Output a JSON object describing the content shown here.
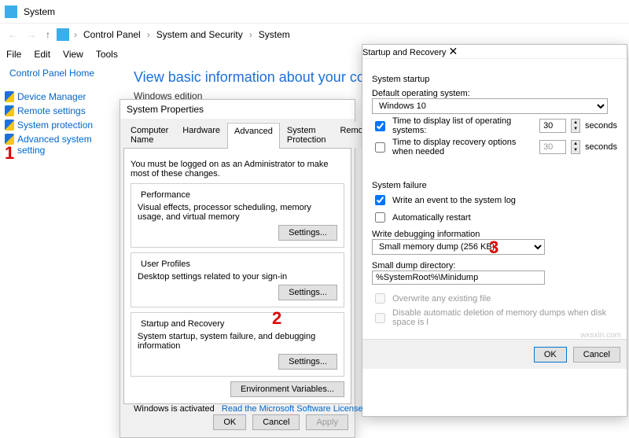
{
  "window": {
    "title": "System"
  },
  "breadcrumb": {
    "root": "Control Panel",
    "mid": "System and Security",
    "leaf": "System"
  },
  "menubar": [
    "File",
    "Edit",
    "View",
    "Tools"
  ],
  "sidebar": {
    "home": "Control Panel Home",
    "items": [
      {
        "label": "Device Manager"
      },
      {
        "label": "Remote settings"
      },
      {
        "label": "System protection"
      },
      {
        "label": "Advanced system setting"
      }
    ]
  },
  "main": {
    "heading": "View basic information about your computer",
    "section": "Windows edition"
  },
  "sysprop": {
    "title": "System Properties",
    "tabs": [
      "Computer Name",
      "Hardware",
      "Advanced",
      "System Protection",
      "Remote"
    ],
    "active_tab": 2,
    "note": "You must be logged on as an Administrator to make most of these changes.",
    "perf_title": "Performance",
    "perf_desc": "Visual effects, processor scheduling, memory usage, and virtual memory",
    "profiles_title": "User Profiles",
    "profiles_desc": "Desktop settings related to your sign-in",
    "startup_title": "Startup and Recovery",
    "startup_desc": "System startup, system failure, and debugging information",
    "settings_btn": "Settings...",
    "env_btn": "Environment Variables...",
    "ok": "OK",
    "cancel": "Cancel",
    "apply": "Apply"
  },
  "sr": {
    "title": "Startup and Recovery",
    "sys_startup": "System startup",
    "default_os_label": "Default operating system:",
    "default_os": "Windows 10",
    "time_list_label": "Time to display list of operating systems:",
    "time_list_val": "30",
    "time_rec_label": "Time to display recovery options when needed",
    "time_rec_val": "30",
    "seconds": "seconds",
    "sys_failure": "System failure",
    "write_event": "Write an event to the system log",
    "auto_restart": "Automatically restart",
    "write_debug_label": "Write debugging information",
    "dump_option": "Small memory dump (256 KB)",
    "small_dump_label": "Small dump directory:",
    "small_dump_val": "%SystemRoot%\\Minidump",
    "overwrite": "Overwrite any existing file",
    "disable_auto": "Disable automatic deletion of memory dumps when disk space is l",
    "ok": "OK",
    "cancel": "Cancel"
  },
  "annotations": {
    "a1": "1",
    "a2": "2",
    "a3": "3"
  },
  "footer": {
    "activated": "Windows is activated",
    "link": "Read the Microsoft Software License"
  },
  "watermark": "wxsxin.com"
}
